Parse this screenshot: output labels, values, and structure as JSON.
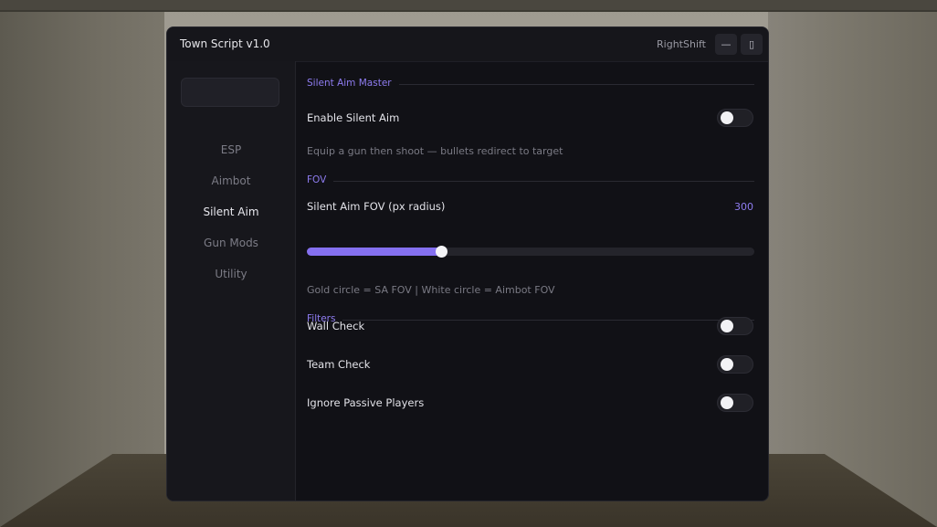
{
  "window": {
    "title": "Town Script v1.0",
    "hotkey": "RightShift",
    "minimize_glyph": "—",
    "close_glyph": "▯"
  },
  "sidebar": {
    "search_value": "",
    "items": [
      {
        "label": "ESP",
        "active": false
      },
      {
        "label": "Aimbot",
        "active": false
      },
      {
        "label": "Silent Aim",
        "active": true
      },
      {
        "label": "Gun Mods",
        "active": false
      },
      {
        "label": "Utility",
        "active": false
      }
    ]
  },
  "content": {
    "sections": {
      "master": "Silent Aim Master",
      "fov": "FOV",
      "filters": "Filters"
    },
    "enable_silent_aim": {
      "label": "Enable Silent Aim",
      "on": false
    },
    "master_hint": "Equip a gun then shoot — bullets redirect to target",
    "fov_slider": {
      "label": "Silent Aim FOV  (px radius)",
      "value": "300",
      "fraction": 0.3
    },
    "fov_hint": "Gold circle = SA FOV  |  White circle = Aimbot FOV",
    "wall_check": {
      "label": "Wall Check",
      "on": false
    },
    "team_check": {
      "label": "Team Check",
      "on": false
    },
    "ignore_passive": {
      "label": "Ignore Passive Players",
      "on": false
    }
  },
  "colors": {
    "accent": "#8570f0",
    "window_bg": "#111116",
    "sidebar_bg": "#17171c"
  }
}
